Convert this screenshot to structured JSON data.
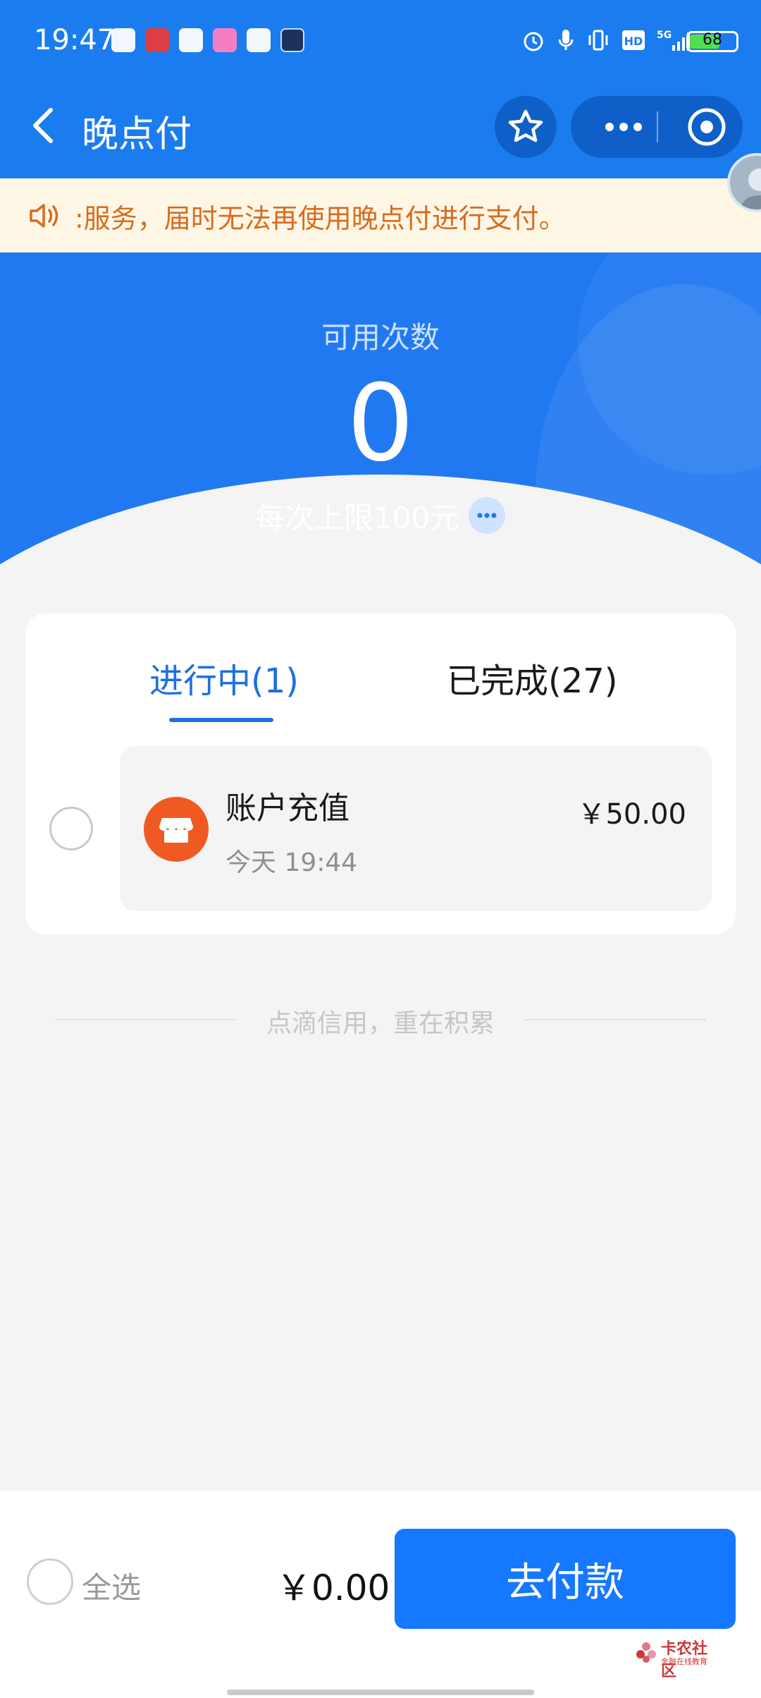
{
  "status_bar": {
    "time": "19:47",
    "battery": "68",
    "battery_level": 0.68,
    "network": "5G"
  },
  "header": {
    "title": "晚点付",
    "back_icon": "chevron-left-icon",
    "favorite_icon": "star-icon",
    "more_icon": "more-dots-icon",
    "close_icon": "target-icon"
  },
  "notice": {
    "text": ":服务，届时无法再使用晚点付进行支付。"
  },
  "summary": {
    "available_label": "可用次数",
    "available_count": "0",
    "limit_text": "每次上限100元"
  },
  "tabs": [
    {
      "label": "进行中(1)",
      "active": true
    },
    {
      "label": "已完成(27)",
      "active": false
    }
  ],
  "orders": [
    {
      "title": "账户充值",
      "time": "今天 19:44",
      "amount": "￥50.00",
      "icon": "shop-icon"
    }
  ],
  "slogan": "点滴信用，重在积累",
  "bottom_bar": {
    "select_all_label": "全选",
    "total": "￥0.00",
    "pay_button": "去付款"
  },
  "watermark": {
    "name": "卡农社区",
    "sub": "金融在线教育"
  },
  "colors": {
    "primary": "#1677ff",
    "header_blue": "#1b7cf0",
    "notice_text": "#d86c1f",
    "notice_bg": "#fff7e6",
    "shop_orange": "#f05a22"
  }
}
